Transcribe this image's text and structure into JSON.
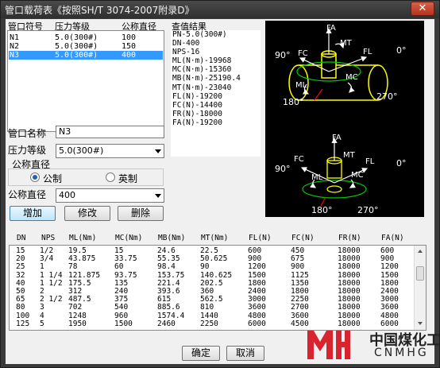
{
  "window": {
    "title": "管口载荷表《按照SH/T 3074-2007附录D》",
    "close_label": "✕"
  },
  "nozzle_list": {
    "headers": [
      "管口符号",
      "压力等级",
      "公称直径"
    ],
    "rows": [
      {
        "symbol": "N1",
        "pressure": "5.0(300#)",
        "dn": "100",
        "selected": false
      },
      {
        "symbol": "N2",
        "pressure": "5.0(300#)",
        "dn": "150",
        "selected": false
      },
      {
        "symbol": "N3",
        "pressure": "5.0(300#)",
        "dn": "400",
        "selected": true
      }
    ]
  },
  "result": {
    "title": "查值结果",
    "lines": [
      "PN-5.0(300#)",
      "DN-400",
      "NPS-16",
      "ML(N·m)-19968",
      "MC(N·m)-15360",
      "MB(N·m)-25190.4",
      "MT(N·m)-23040",
      "FL(N)-19200",
      "FC(N)-14400",
      "FR(N)-18000",
      "FA(N)-19200"
    ]
  },
  "diagram": {
    "top": {
      "fa": "FA",
      "mt": "MT",
      "fl": "FL",
      "fc": "FC",
      "ml": "ML",
      "mc": "MC",
      "a90": "90°",
      "a0": "0°",
      "a180": "180°",
      "a270": "270°"
    },
    "bottom": {
      "fa": "FA",
      "fc": "FC",
      "fl": "FL",
      "ml": "ML",
      "mc": "MC",
      "mt": "MT",
      "a90": "90°",
      "a0": "0°",
      "a180": "180°",
      "a270": "270°"
    }
  },
  "form": {
    "name_label": "管口名称",
    "name_value": "N3",
    "pressure_label": "压力等级",
    "pressure_value": "5.0(300#)",
    "dn_group_label": "公称直径",
    "radio_metric": "公制",
    "radio_imperial": "英制",
    "dn_label": "公称直径",
    "dn_value": "400"
  },
  "buttons": {
    "add": "增加",
    "modify": "修改",
    "delete": "删除",
    "ok": "确定",
    "cancel": "取消"
  },
  "table": {
    "headers": [
      "DN",
      "NPS",
      "ML(Nm)",
      "MC(Nm)",
      "MB(Nm)",
      "MT(Nm)",
      "FL(N)",
      "FC(N)",
      "FR(N)",
      "FA(N)"
    ],
    "rows": [
      [
        "15",
        "1/2",
        "19.5",
        "15",
        "24.6",
        "22.5",
        "600",
        "450",
        "18000",
        "600"
      ],
      [
        "20",
        "3/4",
        "43.875",
        "33.75",
        "55.35",
        "50.625",
        "900",
        "675",
        "18000",
        "900"
      ],
      [
        "25",
        "1",
        "78",
        "60",
        "98.4",
        "90",
        "1200",
        "900",
        "18000",
        "1200"
      ],
      [
        "32",
        "1 1/4",
        "121.875",
        "93.75",
        "153.75",
        "140.625",
        "1500",
        "1125",
        "18000",
        "1500"
      ],
      [
        "40",
        "1 1/2",
        "175.5",
        "135",
        "221.4",
        "202.5",
        "1800",
        "1350",
        "18000",
        "1800"
      ],
      [
        "50",
        "2",
        "312",
        "240",
        "393.6",
        "360",
        "2400",
        "1800",
        "18000",
        "2400"
      ],
      [
        "65",
        "2 1/2",
        "487.5",
        "375",
        "615",
        "562.5",
        "3000",
        "2250",
        "18000",
        "3000"
      ],
      [
        "80",
        "3",
        "702",
        "540",
        "885.6",
        "810",
        "3600",
        "2700",
        "18000",
        "3600"
      ],
      [
        "100",
        "4",
        "1248",
        "960",
        "1574.4",
        "1440",
        "4800",
        "3600",
        "18000",
        "4800"
      ],
      [
        "125",
        "5",
        "1950",
        "1500",
        "2460",
        "2250",
        "6000",
        "4500",
        "18000",
        "6000"
      ]
    ]
  },
  "watermark": {
    "cn": "中国煤化工",
    "en": "CNMHG"
  },
  "colors": {
    "accent": "#3399ff",
    "diagram_bg": "#000000",
    "drawing_green": "#00cc00",
    "drawing_yellow": "#ffff00",
    "drawing_white": "#ffffff",
    "logo_red": "#d9232e"
  }
}
